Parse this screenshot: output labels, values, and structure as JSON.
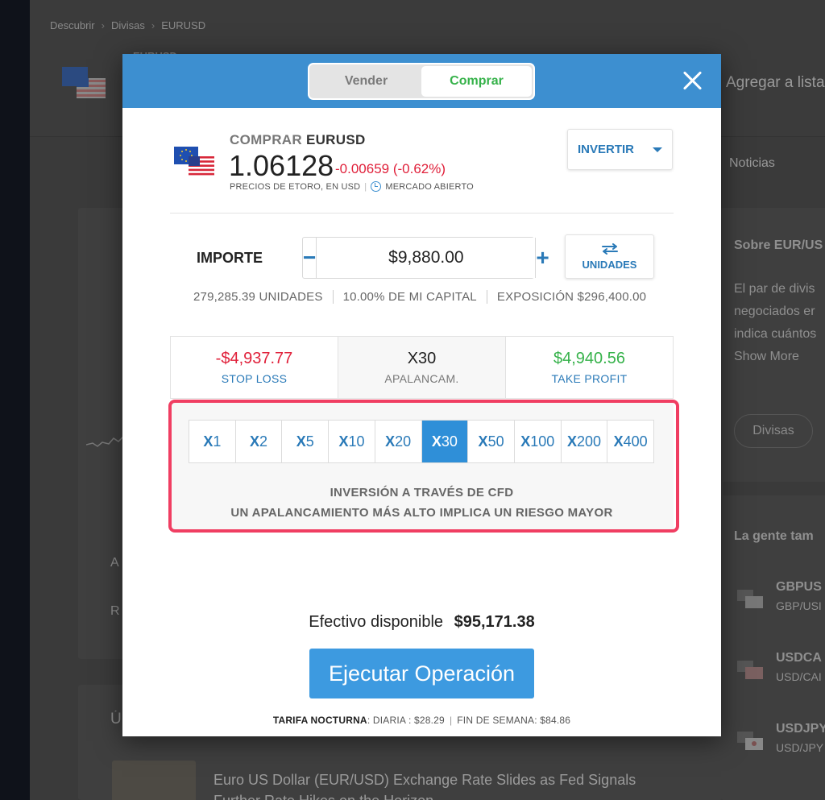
{
  "background": {
    "breadcrumb": [
      "Descubrir",
      "Divisas",
      "EURUSD"
    ],
    "instrument_title": "EURUSD",
    "add_to_list": "Agregar a lista",
    "news_tab": "Noticias",
    "about_title": "Sobre EUR/US",
    "about_lines": [
      "El par de divis",
      "negociados er",
      "indica cuántos"
    ],
    "show_more": "Show More",
    "tag_chip": "Divisas",
    "people_also": "La gente tam",
    "related": [
      {
        "symbol": "GBPUS",
        "pair": "GBP/USI"
      },
      {
        "symbol": "USDCA",
        "pair": "USD/CAI"
      },
      {
        "symbol": "USDJPY",
        "pair": "USD/JPY"
      }
    ],
    "left_letters": [
      "A",
      "R",
      "Ú"
    ],
    "news_headline": "Euro US Dollar (EUR/USD) Exchange Rate Slides as Fed Signals Further Rate Hikes on the Horizon"
  },
  "modal": {
    "toggle": {
      "sell": "Vender",
      "buy": "Comprar",
      "active": "buy"
    },
    "instrument": {
      "action": "COMPRAR",
      "symbol": "EURUSD",
      "price": "1.06128",
      "change": "-0.00659 (-0.62%)",
      "price_source": "PRECIOS DE ETORO, EN USD",
      "market_status": "MERCADO ABIERTO",
      "flag_icon": "eu-us-flag-icon"
    },
    "invest_dropdown": "INVERTIR",
    "amount": {
      "label": "IMPORTE",
      "value": "$9,880.00",
      "minus": "−",
      "plus": "+",
      "units_button": "UNIDADES",
      "units": "279,285.39 UNIDADES",
      "capital": "10.00% DE MI CAPITAL",
      "exposure": "EXPOSICIÓN $296,400.00"
    },
    "risk": {
      "stop_loss_value": "-$4,937.77",
      "stop_loss_label": "STOP LOSS",
      "leverage_value": "X30",
      "leverage_label": "APALANCAM.",
      "take_profit_value": "$4,940.56",
      "take_profit_label": "TAKE PROFIT"
    },
    "leverage_options": [
      {
        "prefix": "X",
        "n": "1"
      },
      {
        "prefix": "X",
        "n": "2"
      },
      {
        "prefix": "X",
        "n": "5"
      },
      {
        "prefix": "X",
        "n": "10"
      },
      {
        "prefix": "X",
        "n": "20"
      },
      {
        "prefix": "X",
        "n": "30"
      },
      {
        "prefix": "X",
        "n": "50"
      },
      {
        "prefix": "X",
        "n": "100"
      },
      {
        "prefix": "X",
        "n": "200"
      },
      {
        "prefix": "X",
        "n": "400"
      }
    ],
    "leverage_selected": "X30",
    "leverage_note_1": "INVERSIÓN A TRAVÉS DE CFD",
    "leverage_note_2": "UN APALANCAMIENTO MÁS ALTO IMPLICA UN RIESGO MAYOR",
    "cash_label": "Efectivo disponible",
    "cash_value": "$95,171.38",
    "execute_button": "Ejecutar Operación",
    "fee": {
      "label": "TARIFA NOCTURNA",
      "daily": ": DIARIA : $28.29",
      "weekend": "FIN DE SEMANA: $84.86"
    }
  },
  "colors": {
    "header_blue": "#3d8fd0",
    "buy_green": "#36b24a",
    "loss_red": "#e0203a",
    "link_blue": "#2a7ab8",
    "highlight_pink": "#f03e62",
    "execute_blue": "#3d9ae0"
  }
}
